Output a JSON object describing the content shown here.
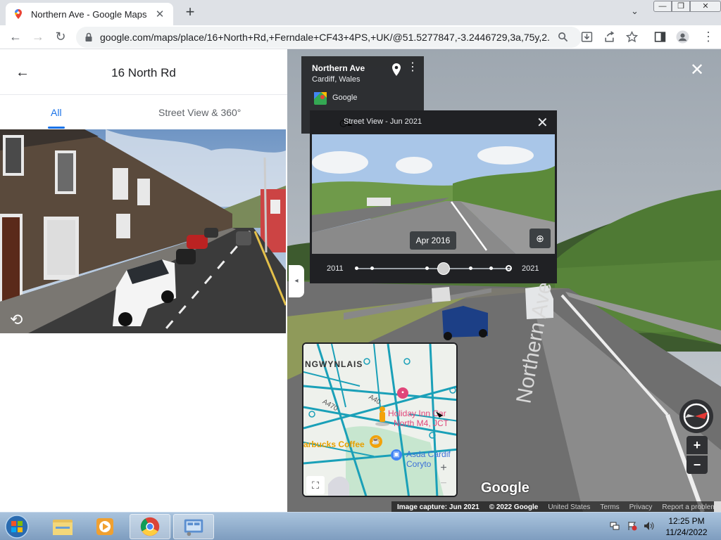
{
  "browser": {
    "tab_title": "Northern Ave - Google Maps",
    "tab_close": "✕",
    "new_tab": "+",
    "tab_menu": "⌄",
    "window_buttons": [
      "—",
      "❐",
      "✕"
    ],
    "url": "google.com/maps/place/16+North+Rd,+Ferndale+CF43+4PS,+UK/@51.5277847,-3.2446729,3a,75y,2...",
    "nav_back": "←",
    "nav_forward": "→",
    "nav_reload": "↻",
    "toolbar_menu": "⋮"
  },
  "side_panel": {
    "back": "←",
    "title": "16 North Rd",
    "tabs": [
      {
        "label": "All",
        "active": true
      },
      {
        "label": "Street View & 360°",
        "active": false
      }
    ],
    "rotate_icon": "⟲"
  },
  "street_view": {
    "collapse": "◂",
    "close": "✕",
    "info_card": {
      "street": "Northern Ave",
      "city": "Cardiff, Wales",
      "source": "Google"
    },
    "time_machine": {
      "title": "Street View - Jun 2021",
      "close": "✕",
      "selected_date": "Apr 2016",
      "year_start": "2011",
      "year_end": "2021",
      "history_icon": "◷▴"
    },
    "minimap": {
      "labels": [
        "NGWYNLAIS",
        "Holiday Inn Car",
        "North M4, JCT",
        "arbucks Coffee",
        "Asda Cardif",
        "Coryto",
        "A470",
        "A40"
      ],
      "zoom_in": "+",
      "zoom_out": "−",
      "fullscreen": "⛶"
    },
    "road_label": "Northern Ave",
    "zoom_in": "+",
    "zoom_out": "−",
    "logo": "Google",
    "footer": {
      "capture": "Image capture: Jun 2021",
      "copyright": "© 2022 Google",
      "region": "United States",
      "terms": "Terms",
      "privacy": "Privacy",
      "report": "Report a problem"
    }
  },
  "taskbar": {
    "time": "12:25 PM",
    "date": "11/24/2022"
  },
  "colors": {
    "accent": "#1a73e8",
    "map_roads": "#1aa0b8",
    "map_poi": "#e0467a",
    "map_food": "#f2a20a"
  }
}
